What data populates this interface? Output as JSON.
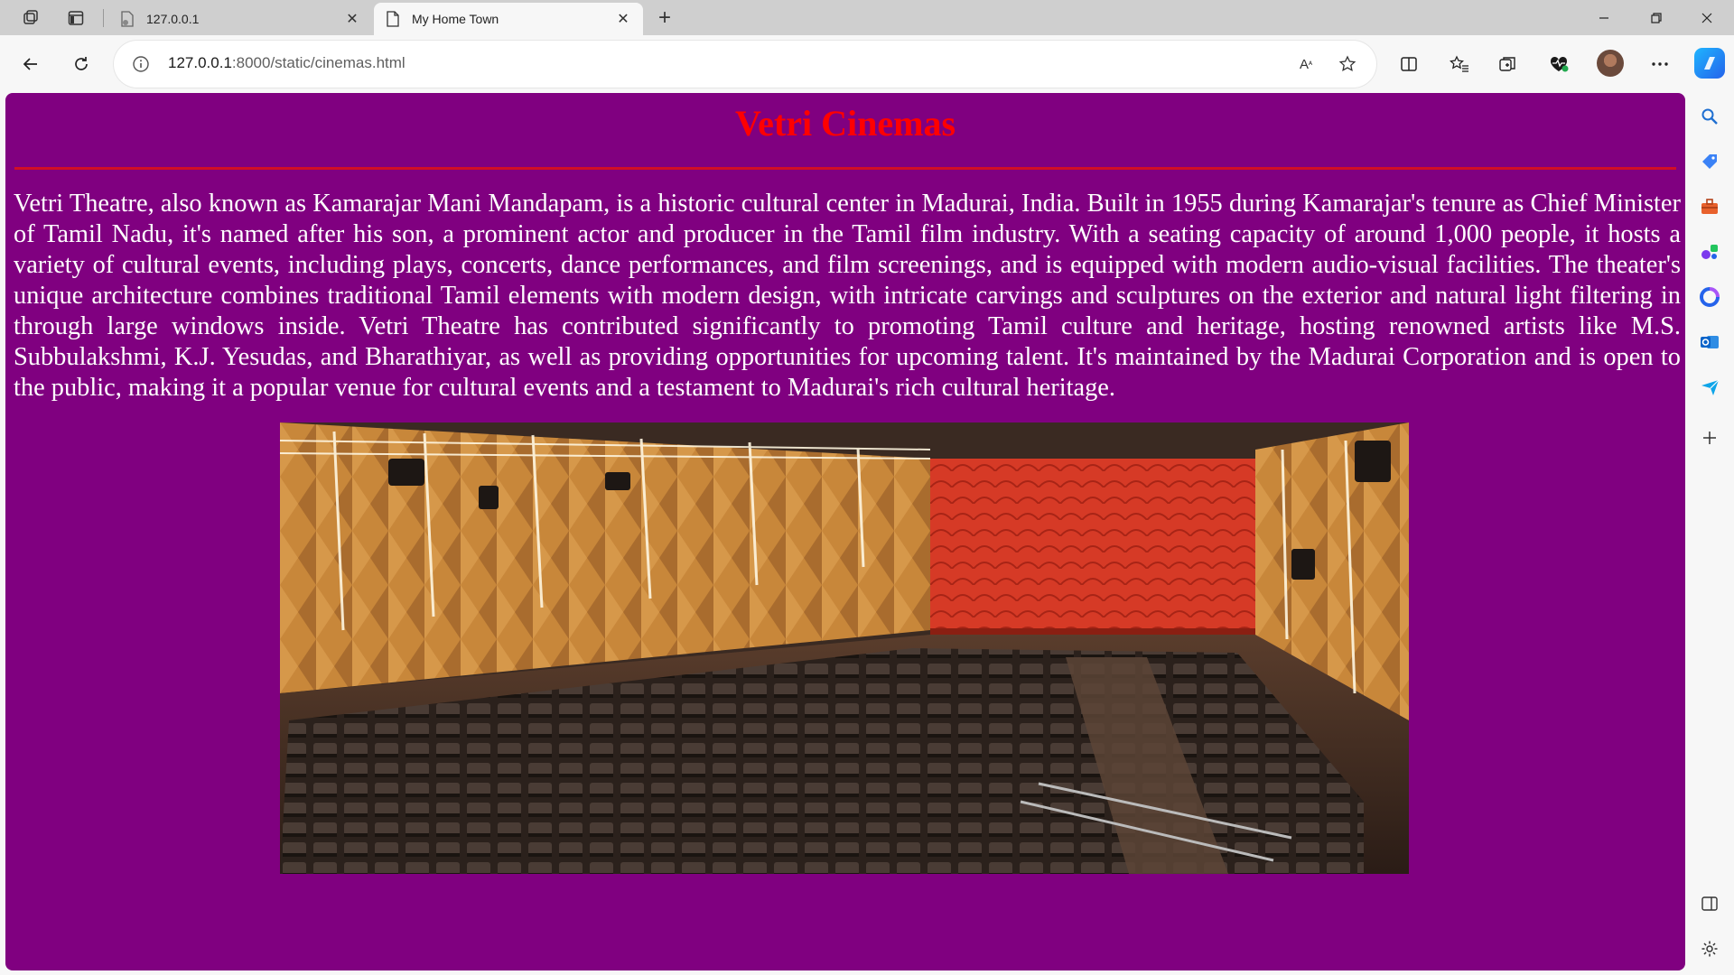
{
  "browser": {
    "tabs": [
      {
        "title": "127.0.0.1",
        "active": false
      },
      {
        "title": "My Home Town",
        "active": true
      }
    ],
    "address": {
      "host": "127.0.0.1",
      "rest": ":8000/static/cinemas.html"
    }
  },
  "page": {
    "title": "Vetri Cinemas",
    "paragraph": "Vetri Theatre, also known as Kamarajar Mani Mandapam, is a historic cultural center in Madurai, India. Built in 1955 during Kamarajar's tenure as Chief Minister of Tamil Nadu, it's named after his son, a prominent actor and producer in the Tamil film industry. With a seating capacity of around 1,000 people, it hosts a variety of cultural events, including plays, concerts, dance performances, and film screenings, and is equipped with modern audio-visual facilities. The theater's unique architecture combines traditional Tamil elements with modern design, with intricate carvings and sculptures on the exterior and natural light filtering in through large windows inside. Vetri Theatre has contributed significantly to promoting Tamil culture and heritage, hosting renowned artists like M.S. Subbulakshmi, K.J. Yesudas, and Bharathiyar, as well as providing opportunities for upcoming talent. It's maintained by the Madurai Corporation and is open to the public, making it a popular venue for cultural events and a testament to Madurai's rich cultural heritage.",
    "background_color": "#800080",
    "title_color": "#ff0000",
    "rule_color": "#d10f25"
  },
  "icons": {
    "workspaces": "workspaces-icon",
    "tab_actions": "tab-actions-icon",
    "back": "back-arrow-icon",
    "refresh": "refresh-icon",
    "info": "site-info-icon",
    "read_aloud": "read-aloud-icon",
    "favorite": "star-icon",
    "split": "split-screen-icon",
    "favorites": "favorites-icon",
    "collections": "collections-icon",
    "health": "browser-essentials-icon",
    "more": "more-icon",
    "copilot": "copilot-icon"
  }
}
